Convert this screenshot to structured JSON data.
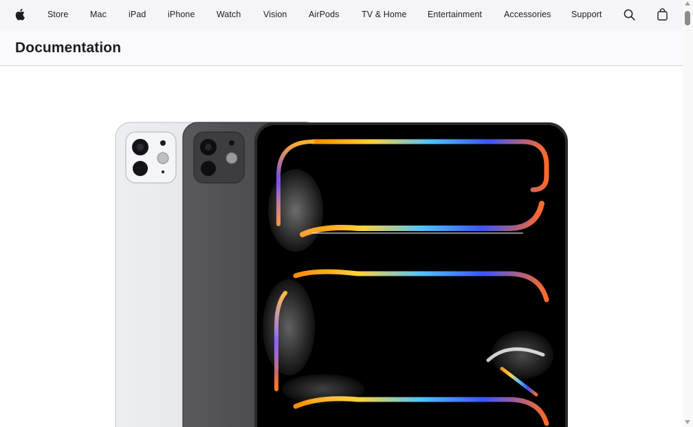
{
  "nav": {
    "apple_icon": "apple-logo-icon",
    "items": [
      "Store",
      "Mac",
      "iPad",
      "iPhone",
      "Watch",
      "Vision",
      "AirPods",
      "TV & Home",
      "Entertainment",
      "Accessories",
      "Support"
    ],
    "search_icon": "search-icon",
    "bag_icon": "shopping-bag-icon"
  },
  "subnav": {
    "title": "Documentation"
  },
  "hero": {
    "image": "ipad-pro-product-image"
  },
  "colors": {
    "nav_bg": "#f5f5f7",
    "text": "#1d1d1f"
  }
}
